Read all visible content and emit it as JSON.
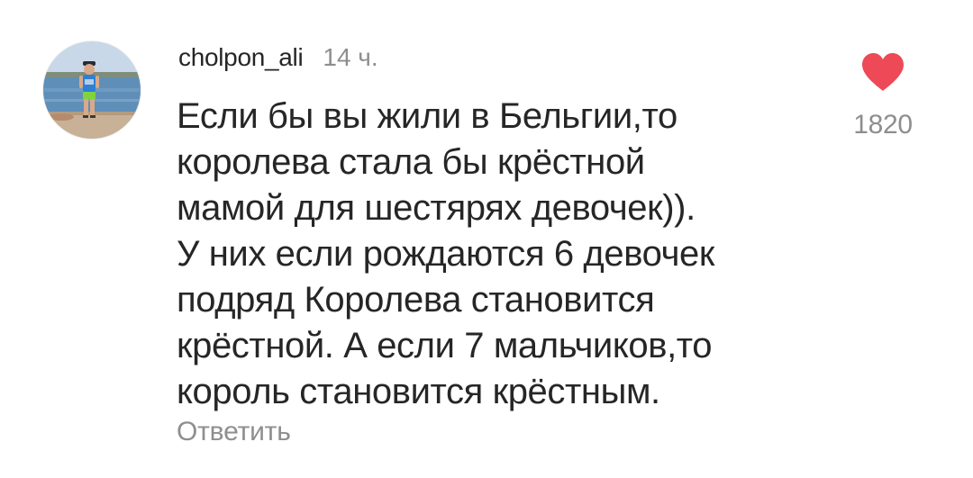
{
  "comment": {
    "username": "cholpon_ali",
    "timestamp": "14 ч.",
    "text": "Если бы вы жили в Бельгии,то\nкоролева стала бы крёстной\nмамой для шестярях девочек)).\nУ них если рождаются 6 девочек\nподряд Королева становится\nкрёстной. А если 7 мальчиков,то\nкороль становится крёстным.",
    "reply_label": "Ответить",
    "like_count": "1820",
    "liked": true
  },
  "icons": {
    "like": "heart-icon",
    "avatar": "avatar"
  },
  "colors": {
    "heart": "#ed4956",
    "primary_text": "#262626",
    "secondary_text": "#8e8e8e",
    "background": "#ffffff"
  }
}
